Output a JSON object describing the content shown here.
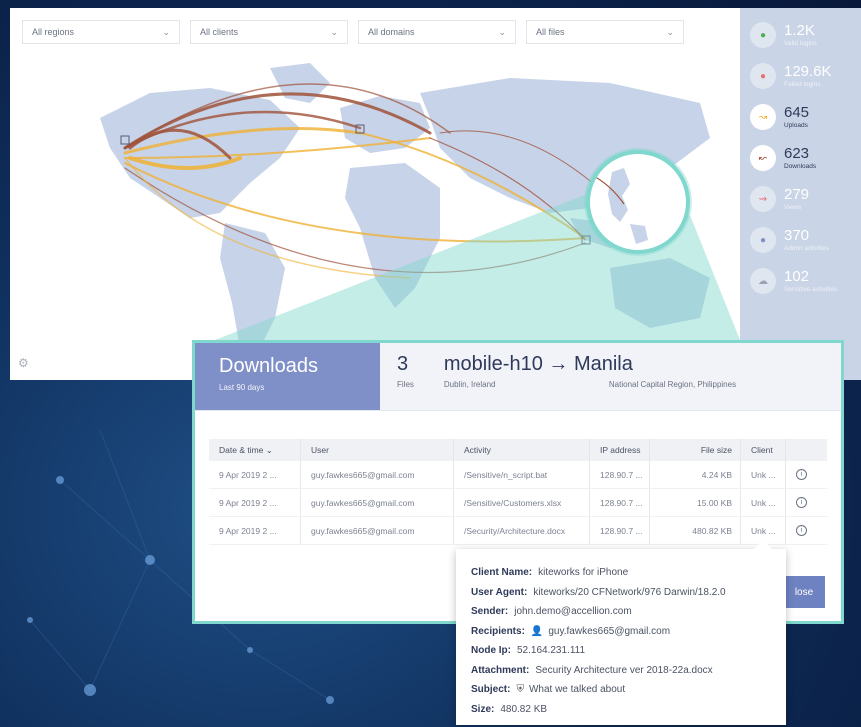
{
  "filters": [
    {
      "label": "All regions"
    },
    {
      "label": "All clients"
    },
    {
      "label": "All domains"
    },
    {
      "label": "All files"
    }
  ],
  "stats": [
    {
      "value": "1.2K",
      "label": "Valid logins",
      "icon": "dot-icon"
    },
    {
      "value": "129.6K",
      "label": "Failed logins",
      "icon": "dot-icon"
    },
    {
      "value": "645",
      "label": "Uploads",
      "icon": "upload-arrow-icon"
    },
    {
      "value": "623",
      "label": "Downloads",
      "icon": "download-arrow-icon"
    },
    {
      "value": "279",
      "label": "Views",
      "icon": "view-icon"
    },
    {
      "value": "370",
      "label": "Admin activities",
      "icon": "dot-icon"
    },
    {
      "value": "102",
      "label": "Sensitive activities",
      "icon": "cloud-icon"
    }
  ],
  "popup": {
    "title": "Downloads",
    "subtitle": "Last 90 days",
    "count": "3",
    "count_label": "Files",
    "route": "mobile-h10 → Manila",
    "from_location": "Dublin, Ireland",
    "to_location": "National Capital Region, Philippines",
    "columns": [
      "Date & time",
      "User",
      "Activity",
      "IP address",
      "File size",
      "Client"
    ],
    "rows": [
      {
        "date": "9 Apr 2019 2 ...",
        "user": "guy.fawkes665@gmail.com",
        "activity": "/Sensitive/n_script.bat",
        "ip": "128.90.7 ...",
        "size": "4.24 KB",
        "client": "Unk ..."
      },
      {
        "date": "9 Apr 2019 2 ...",
        "user": "guy.fawkes665@gmail.com",
        "activity": "/Sensitive/Customers.xlsx",
        "ip": "128.90.7 ...",
        "size": "15.00 KB",
        "client": "Unk ..."
      },
      {
        "date": "9 Apr 2019 2 ...",
        "user": "guy.fawkes665@gmail.com",
        "activity": "/Security/Architecture.docx",
        "ip": "128.90.7 ...",
        "size": "480.82 KB",
        "client": "Unk ..."
      }
    ],
    "close_label": "lose"
  },
  "tooltip": {
    "client_name_label": "Client Name:",
    "client_name": "kiteworks for iPhone",
    "user_agent_label": "User Agent:",
    "user_agent": "kiteworks/20 CFNetwork/976 Darwin/18.2.0",
    "sender_label": "Sender:",
    "sender": "john.demo@accellion.com",
    "recipients_label": "Recipients:",
    "recipients": "guy.fawkes665@gmail.com",
    "node_ip_label": "Node Ip:",
    "node_ip": "52.164.231.111",
    "attachment_label": "Attachment:",
    "attachment": "Security Architecture ver 2018-22a.docx",
    "subject_label": "Subject:",
    "subject": "What we talked about",
    "size_label": "Size:",
    "size": "480.82 KB"
  },
  "colors": {
    "accent": "#7f8fc7",
    "teal": "#7fd7cd",
    "upload": "#f0b233",
    "download": "#a0523a"
  }
}
